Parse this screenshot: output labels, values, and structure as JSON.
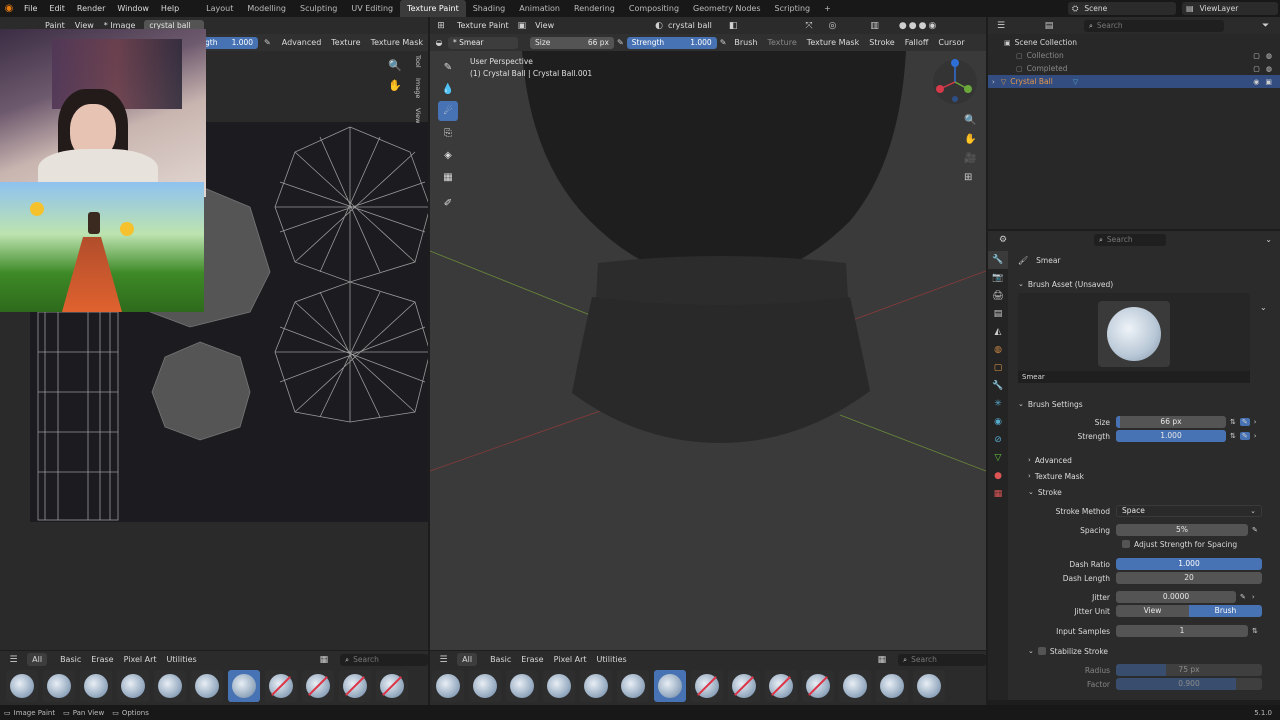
{
  "topbar": {
    "menus": [
      "File",
      "Edit",
      "Render",
      "Window",
      "Help"
    ],
    "workspaces": [
      "Layout",
      "Modelling",
      "Sculpting",
      "UV Editing",
      "Texture Paint",
      "Shading",
      "Animation",
      "Rendering",
      "Compositing",
      "Geometry Nodes",
      "Scripting"
    ],
    "active_workspace": "Texture Paint",
    "add_tab": "+",
    "scene_label": "Scene",
    "viewlayer_label": "ViewLayer"
  },
  "image_editor": {
    "header": {
      "mode": "Paint",
      "view": "View",
      "image": "* Image",
      "image_name": "crystal ball"
    },
    "tool_header": {
      "strength_label": "gth",
      "strength_value": "1.000",
      "advanced": "Advanced",
      "texture": "Texture",
      "texture_mask": "Texture Mask"
    },
    "side_tabs": [
      "Tool",
      "Image",
      "View"
    ]
  },
  "viewport": {
    "header": {
      "mode": "Texture Paint",
      "view": "View",
      "object_name": "crystal ball"
    },
    "tool_header": {
      "brush_name": "* Smear",
      "size_label": "Size",
      "size_value": "66 px",
      "strength_label": "Strength",
      "strength_value": "1.000",
      "brush": "Brush",
      "texture": "Texture",
      "texture_mask": "Texture Mask",
      "stroke": "Stroke",
      "falloff": "Falloff",
      "cursor": "Cursor"
    },
    "overlay_title": "User Perspective",
    "overlay_subtitle": "(1) Crystal Ball | Crystal Ball.001"
  },
  "outliner": {
    "search_placeholder": "Search",
    "root": "Scene Collection",
    "items": [
      {
        "label": "Collection",
        "dim": true
      },
      {
        "label": "Completed",
        "dim": true
      },
      {
        "label": "Crystal Ball",
        "dim": false,
        "selected": true
      }
    ]
  },
  "properties": {
    "search_placeholder": "Search",
    "breadcrumb": "Smear",
    "brush_asset_header": "Brush Asset (Unsaved)",
    "brush_asset_name": "Smear",
    "brush_settings_header": "Brush Settings",
    "size_label": "Size",
    "size_value": "66 px",
    "size_fill": 0.04,
    "strength_label": "Strength",
    "strength_value": "1.000",
    "strength_fill": 1.0,
    "advanced": "Advanced",
    "texture_mask": "Texture Mask",
    "stroke": "Stroke",
    "stroke_method_label": "Stroke Method",
    "stroke_method_value": "Space",
    "spacing_label": "Spacing",
    "spacing_value": "5%",
    "adjust_strength_label": "Adjust Strength for Spacing",
    "dash_ratio_label": "Dash Ratio",
    "dash_ratio_value": "1.000",
    "dash_length_label": "Dash Length",
    "dash_length_value": "20",
    "jitter_label": "Jitter",
    "jitter_value": "0.0000",
    "jitter_unit_label": "Jitter Unit",
    "jitter_unit_view": "View",
    "jitter_unit_brush": "Brush",
    "input_samples_label": "Input Samples",
    "input_samples_value": "1",
    "stabilize_label": "Stabilize Stroke",
    "radius_label": "Radius",
    "radius_value": "75 px",
    "factor_label": "Factor",
    "factor_value": "0.900"
  },
  "asset_shelf": {
    "tabs": [
      "All",
      "Basic",
      "Erase",
      "Pixel Art",
      "Utilities"
    ],
    "search_placeholder": "Search"
  },
  "statusbar": {
    "items": [
      "Image Paint",
      "Pan View",
      "Options"
    ],
    "version": "5.1.0"
  },
  "colors": {
    "accent": "#4772b3",
    "bg": "#1d1d1d",
    "panel": "#303030",
    "header": "#2b2b2b"
  }
}
